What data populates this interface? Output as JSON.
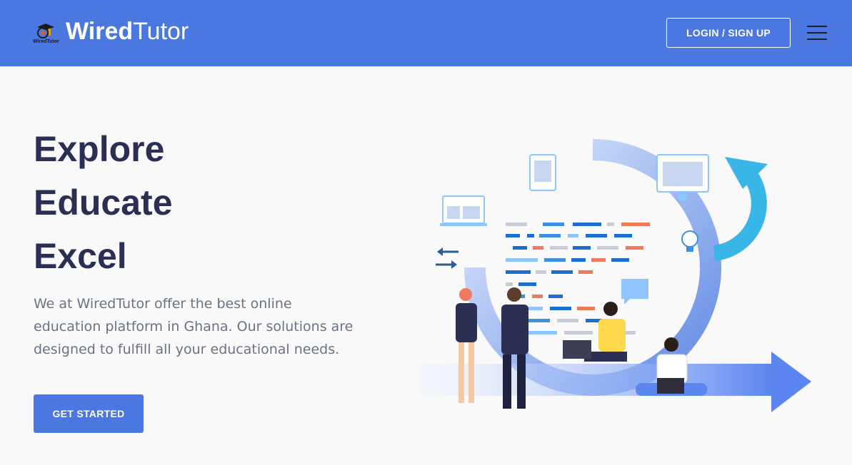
{
  "header": {
    "brand_bold": "Wired",
    "brand_regular": "Tutor",
    "logo_caption": "WiredTutor",
    "login_label": "LOGIN / SIGN UP",
    "menu_icon": "hamburger-menu-icon"
  },
  "hero": {
    "title_lines": [
      "Explore",
      "Educate",
      "Excel"
    ],
    "description": "We at WiredTutor offer the best online education platform in Ghana. Our solutions are designed to fulfill all your educational needs.",
    "cta_label": "GET STARTED"
  },
  "colors": {
    "brand_blue": "#4a78e0",
    "title_navy": "#2c2f54",
    "text_gray": "#6b7280",
    "background": "#f9f9f9"
  }
}
